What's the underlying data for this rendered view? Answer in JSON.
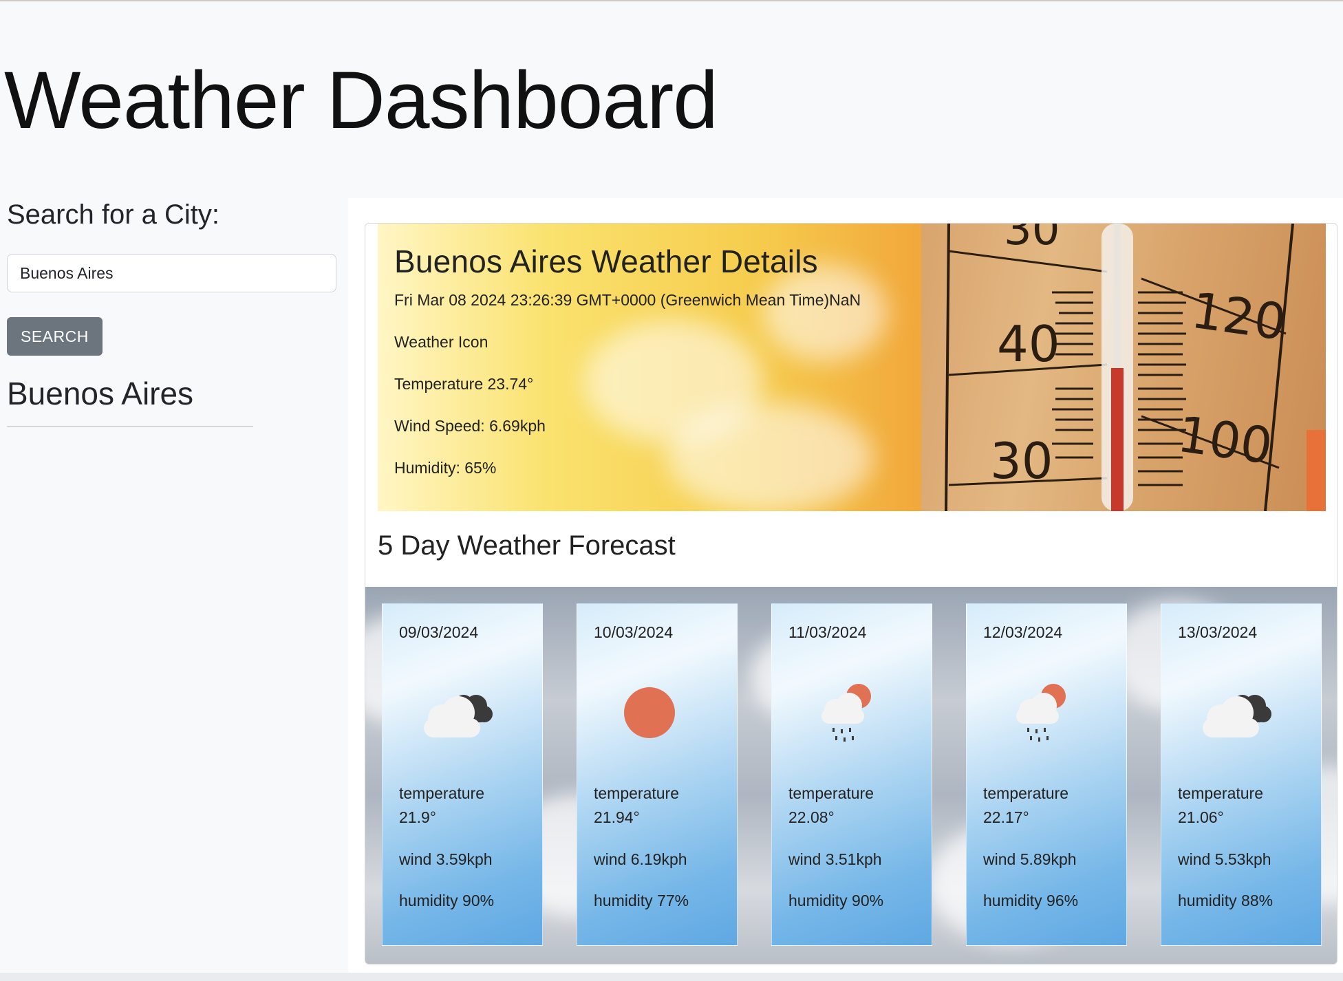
{
  "header": {
    "title": "Weather Dashboard"
  },
  "sidebar": {
    "search_heading": "Search for a City:",
    "search_value": "Buenos Aires",
    "search_button_label": "SEARCH",
    "history": [
      "Buenos Aires"
    ]
  },
  "current": {
    "title": "Buenos Aires Weather Details",
    "date": "Fri Mar 08 2024 23:26:39 GMT+0000 (Greenwich Mean Time)NaN",
    "icon_text": "Weather Icon",
    "temperature": "Temperature 23.74°",
    "wind": "Wind Speed: 6.69kph",
    "humidity": "Humidity: 65%",
    "thermometer_labels": {
      "top": "30",
      "a": "40",
      "b": "30",
      "c": "120",
      "d": "100"
    }
  },
  "forecast": {
    "heading": "5 Day Weather Forecast",
    "days": [
      {
        "date": "09/03/2024",
        "icon": "broken-clouds-icon",
        "temp_label": "temperature",
        "temp": "21.9°",
        "wind": "wind 3.59kph",
        "humidity": "humidity 90%"
      },
      {
        "date": "10/03/2024",
        "icon": "clear-sky-icon",
        "temp_label": "temperature",
        "temp": "21.94°",
        "wind": "wind 6.19kph",
        "humidity": "humidity 77%"
      },
      {
        "date": "11/03/2024",
        "icon": "rain-icon",
        "temp_label": "temperature",
        "temp": "22.08°",
        "wind": "wind 3.51kph",
        "humidity": "humidity 90%"
      },
      {
        "date": "12/03/2024",
        "icon": "rain-icon",
        "temp_label": "temperature",
        "temp": "22.17°",
        "wind": "wind 5.89kph",
        "humidity": "humidity 96%"
      },
      {
        "date": "13/03/2024",
        "icon": "broken-clouds-icon",
        "temp_label": "temperature",
        "temp": "21.06°",
        "wind": "wind 5.53kph",
        "humidity": "humidity 88%"
      }
    ]
  },
  "colors": {
    "button_bg": "#6c757d",
    "sun": "#e07153",
    "dark_cloud": "#3a3a3a"
  }
}
